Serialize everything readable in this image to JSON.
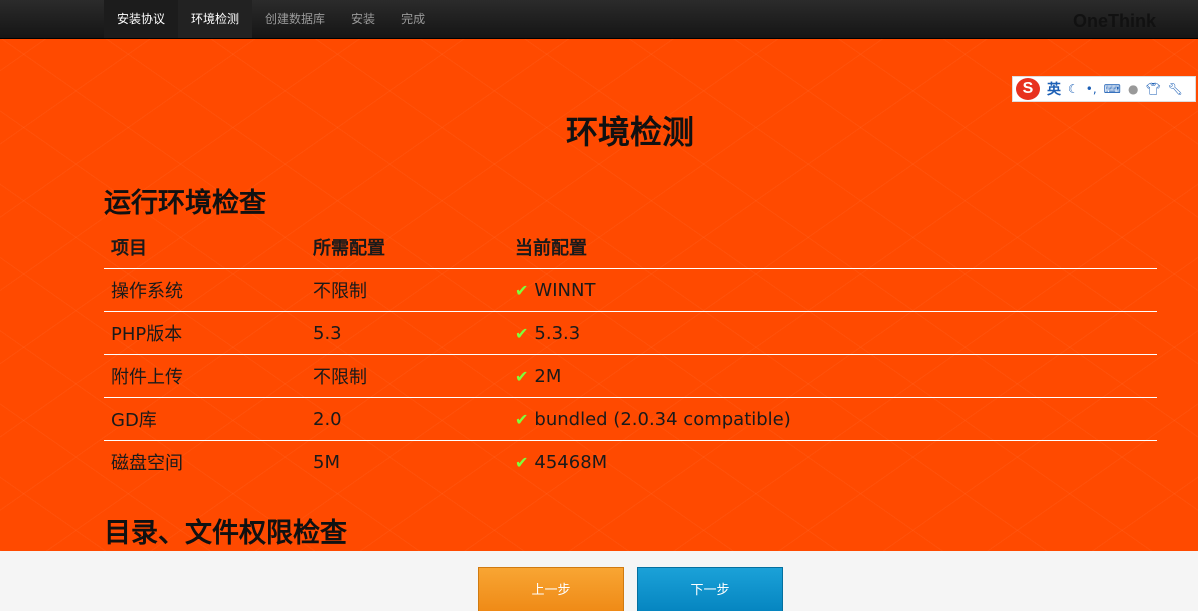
{
  "nav": {
    "items": [
      {
        "label": "安装协议",
        "state": "done"
      },
      {
        "label": "环境检测",
        "state": "active"
      },
      {
        "label": "创建数据库",
        "state": "pending"
      },
      {
        "label": "安装",
        "state": "pending"
      },
      {
        "label": "完成",
        "state": "pending"
      }
    ],
    "brand": "OneThink"
  },
  "ime": {
    "logo": "S",
    "lang": "英",
    "icons": [
      "moon-icon",
      "comma-icon",
      "keyboard-icon",
      "user-icon",
      "shirt-icon",
      "wrench-icon"
    ]
  },
  "page": {
    "title": "环境检测"
  },
  "env_check": {
    "title": "运行环境检查",
    "headers": [
      "项目",
      "所需配置",
      "当前配置"
    ],
    "rows": [
      {
        "item": "操作系统",
        "required": "不限制",
        "current": "WINNT"
      },
      {
        "item": "PHP版本",
        "required": "5.3",
        "current": "5.3.3"
      },
      {
        "item": "附件上传",
        "required": "不限制",
        "current": "2M"
      },
      {
        "item": "GD库",
        "required": "2.0",
        "current": "bundled (2.0.34 compatible)"
      },
      {
        "item": "磁盘空间",
        "required": "5M",
        "current": "45468M"
      }
    ]
  },
  "dir_check": {
    "title": "目录、文件权限检查"
  },
  "footer": {
    "prev_label": "上一步",
    "next_label": "下一步"
  },
  "colors": {
    "background": "#ff4a00",
    "check": "#7dff3c",
    "prev_button": "#ef8a16",
    "next_button": "#0585c0"
  }
}
